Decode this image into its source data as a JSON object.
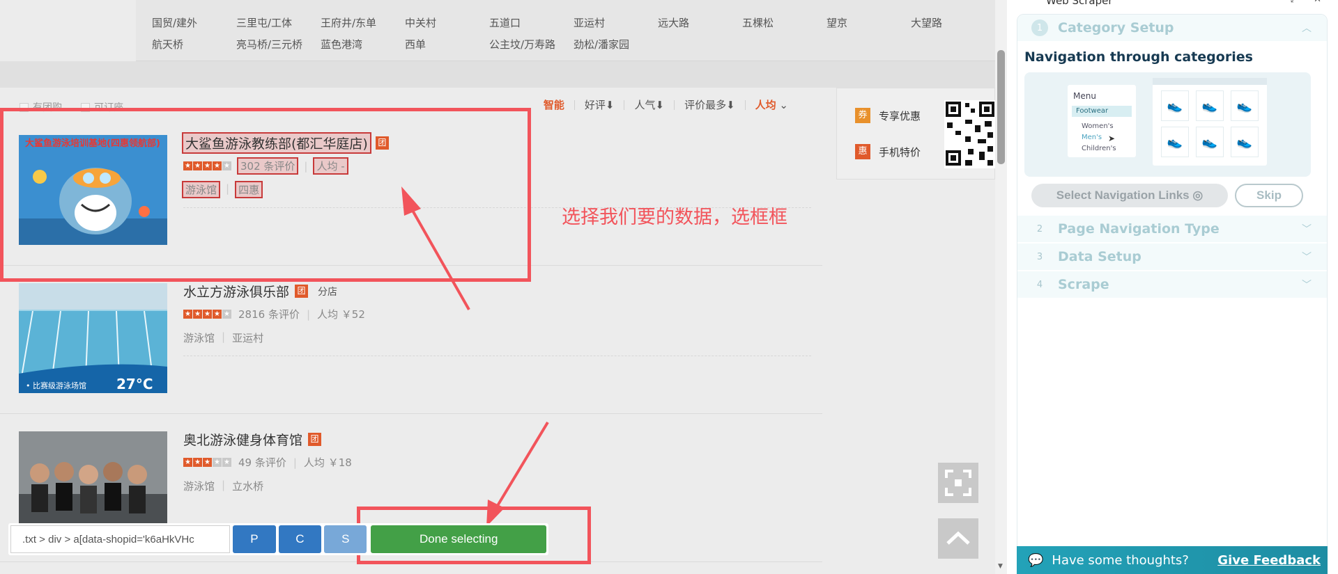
{
  "districts": {
    "row1": [
      "国贸/建外",
      "三里屯/工体",
      "王府井/东单",
      "中关村",
      "五道口",
      "亚运村",
      "远大路",
      "五棵松",
      "望京",
      "大望路"
    ],
    "row2": [
      "航天桥",
      "亮马桥/三元桥",
      "蓝色港湾",
      "西单",
      "公主坟/万寿路",
      "劲松/潘家园"
    ]
  },
  "filters": {
    "checkbox1": "有团购",
    "checkbox2": "可订座",
    "sorts": [
      "智能",
      "好评⬇",
      "人气⬇",
      "评价最多⬇",
      "人均"
    ]
  },
  "shops": [
    {
      "name": "大鲨鱼游泳教练部(都汇华庭店)",
      "badge": "团",
      "branch": "",
      "reviews": "302 条评价",
      "avg": "人均 -",
      "category": "游泳馆",
      "area": "四惠",
      "stars": 4.5,
      "thumb_caption": "大鲨鱼游泳培训基地(四惠领航部)"
    },
    {
      "name": "水立方游泳俱乐部",
      "badge": "团",
      "branch": "分店",
      "reviews": "2816 条评价",
      "avg": "人均 ￥52",
      "category": "游泳馆",
      "area": "亚运村",
      "stars": 4,
      "thumb_caption": "• 比赛级游泳场馆",
      "thumb_temp": "27°C"
    },
    {
      "name": "奥北游泳健身体育馆",
      "badge": "团",
      "branch": "",
      "reviews": "49 条评价",
      "avg": "人均 ￥18",
      "category": "游泳馆",
      "area": "立水桥",
      "stars": 3.5
    }
  ],
  "side_card": {
    "item1_icon": "券",
    "item1": "专享优惠",
    "item2_icon": "惠",
    "item2": "手机特价"
  },
  "annotation": "选择我们要的数据，选框框",
  "selector_bar": {
    "selector_value": ".txt > div > a[data-shopid='k6aHkVHc",
    "btn_p": "P",
    "btn_c": "C",
    "btn_s": "S",
    "done_label": "Done selecting"
  },
  "ext": {
    "title": "Web Scraper",
    "steps": [
      {
        "num": "1",
        "title": "Category Setup",
        "active": true
      },
      {
        "num": "2",
        "title": "Page Navigation Type"
      },
      {
        "num": "3",
        "title": "Data Setup"
      },
      {
        "num": "4",
        "title": "Scrape"
      }
    ],
    "nav_title": "Navigation through categories",
    "illus_menu": {
      "heading": "Menu",
      "selected": "Footwear",
      "items": [
        "Women's",
        "Men's",
        "Children's"
      ]
    },
    "select_nav_label": "Select Navigation Links",
    "skip_label": "Skip",
    "feedback_text": "Have some thoughts?",
    "feedback_link": "Give Feedback"
  },
  "colors": {
    "accent_orange": "#e05a2b",
    "annotation_red": "#f2545b",
    "done_green": "#43a047",
    "btn_blue": "#3278c2",
    "feedback_teal": "#23a2b8"
  }
}
